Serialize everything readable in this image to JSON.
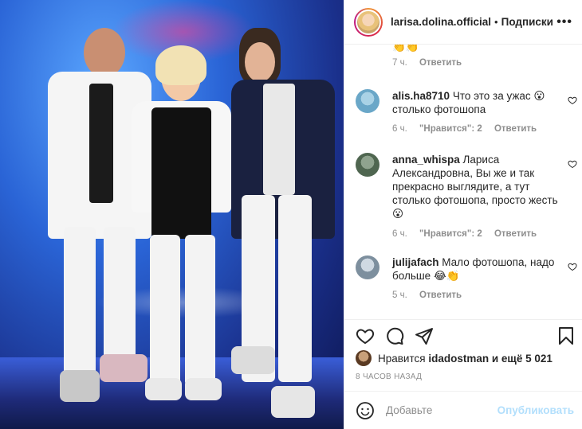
{
  "header": {
    "username": "larisa.dolina.official",
    "separator": "•",
    "follow_label": "Подписки",
    "more_label": "•••"
  },
  "partial_comment": {
    "emoji": "👏👏",
    "time": "7 ч.",
    "reply_label": "Ответить"
  },
  "comments": [
    {
      "username": "alis.ha8710",
      "text": "Что это за ужас 😮 столько фотошопа",
      "time": "6 ч.",
      "likes": "\"Нравится\": 2",
      "reply_label": "Ответить"
    },
    {
      "username": "anna_whispa",
      "text": "Лариса Александровна, Вы же и так прекрасно выглядите, а тут столько фотошопа, просто жесть 😮",
      "time": "6 ч.",
      "likes": "\"Нравится\": 2",
      "reply_label": "Ответить"
    },
    {
      "username": "julijafach",
      "text": "Мало фотошопа, надо больше 😂👏",
      "time": "5 ч.",
      "likes": "",
      "reply_label": "Ответить"
    }
  ],
  "likes": {
    "prefix": "Нравится",
    "user": "idadostman",
    "suffix": "и ещё 5 021"
  },
  "timestamp": "8 ЧАСОВ НАЗАД",
  "add_comment": {
    "placeholder": "Добавьте",
    "post_label": "Опубликовать"
  },
  "icons": {
    "like": "heart-icon",
    "comment": "comment-icon",
    "share": "paper-plane-icon",
    "save": "bookmark-icon",
    "emoji": "smiley-icon"
  },
  "colors": {
    "post_button": "#b2dffc",
    "meta_text": "#8e8e8e"
  }
}
